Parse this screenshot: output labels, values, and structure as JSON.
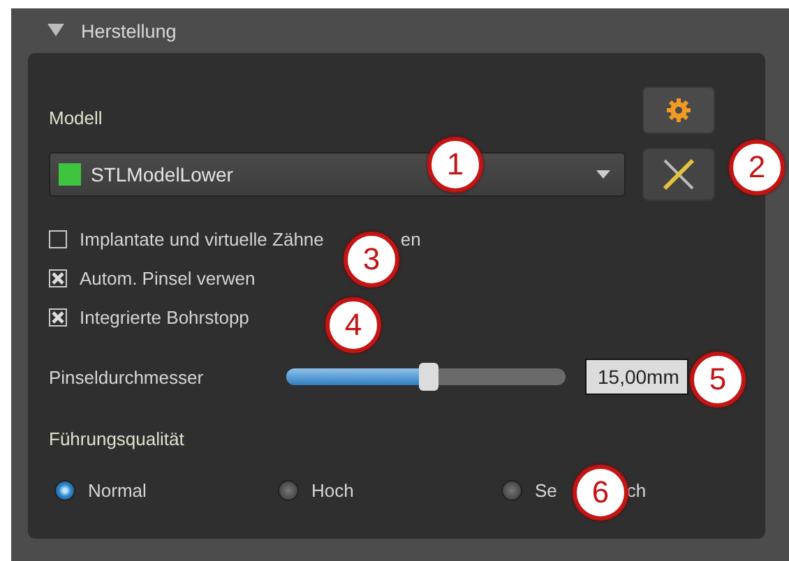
{
  "section": {
    "title": "Herstellung",
    "expanded": true
  },
  "model": {
    "label": "Modell",
    "value": "STLModelLower",
    "color": "#3ec43e"
  },
  "checkboxes": [
    {
      "label": "Implantate und virtuelle Zähne",
      "label_end": "en",
      "checked": false
    },
    {
      "label": "Autom. Pinsel verwen",
      "checked": true
    },
    {
      "label": "Integrierte Bohrstopp",
      "checked": true
    }
  ],
  "slider": {
    "label": "Pinseldurchmesser",
    "level": 0.5,
    "value": "15,00mm"
  },
  "quality": {
    "label": "Führungsqualität",
    "options": [
      {
        "label": "Normal",
        "selected": true
      },
      {
        "label": "Hoch",
        "selected": false
      },
      {
        "label": "Se",
        "label_end": "ch",
        "selected": false
      }
    ]
  },
  "callouts": [
    "1",
    "2",
    "3",
    "4",
    "5",
    "6"
  ]
}
